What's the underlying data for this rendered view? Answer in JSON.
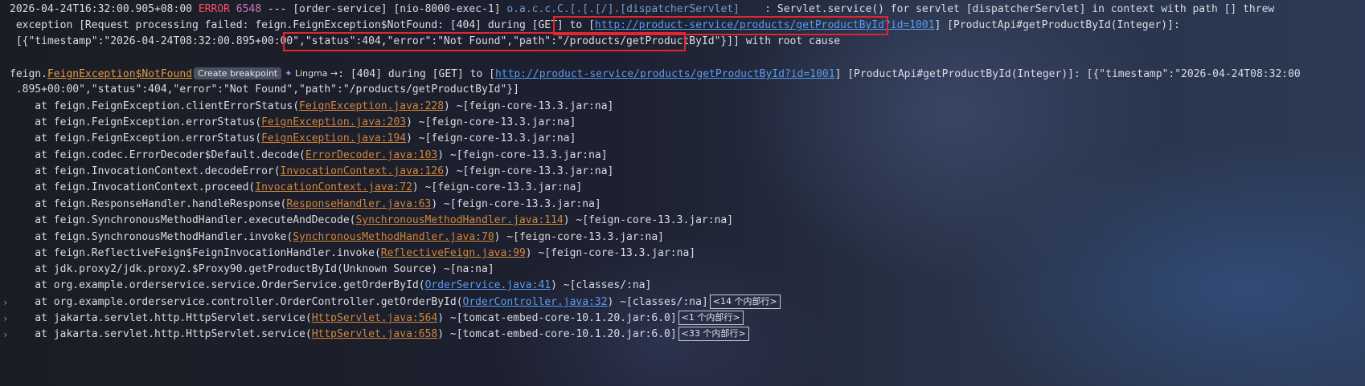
{
  "log": {
    "l1": {
      "timestamp": "2026-04-24T16:32:00.905+08:00",
      "level": "ERROR",
      "pid": "6548",
      "sep": " --- ",
      "service": "[order-service]",
      "thread": "[nio-8000-exec-1]",
      "logger": "o.a.c.c.C.[.[.[/].[dispatcherServlet]",
      "msg": "    : Servlet.service() for servlet [dispatcherServlet] in context with path [] threw"
    },
    "l2": {
      "pre": " exception [Request processing failed: feign.FeignException$NotFound: [404] during [GET] to ",
      "bracket_open": "[",
      "url": "http://product-service/products/getProductById?id=1001",
      "post": "] [ProductApi#getProductById(Integer)]:"
    },
    "l3": {
      "pre": " [{\"timestamp\":\"2026-04-24T08:32:00.895+00:00\"",
      "boxed": ",\"status\":404,\"error\":\"Not Found\",\"path\":\"/products/getProductById\"",
      "post": "}]] with root cause"
    },
    "l4": {
      "pre": "feign.",
      "cls": "FeignException$NotFound",
      "badge": "Create breakpoint",
      "lingma_icon": "✦",
      "lingma": "Lingma →",
      "mid": ": [404] during [GET] to [",
      "url": "http://product-service/products/getProductById?id=1001",
      "post": "] [ProductApi#getProductById(Integer)]: [{\"timestamp\":\"2026-04-24T08:32:00"
    },
    "l5": {
      "text": " .895+00:00\",\"status\":404,\"error\":\"Not Found\",\"path\":\"/products/getProductById\"}]"
    },
    "frames": [
      {
        "pre": "    at feign.FeignException.clientErrorStatus(",
        "link": "FeignException.java:228",
        "post": ") ~[feign-core-13.3.jar:na]",
        "kind": "feign",
        "gutter": "",
        "fold": ""
      },
      {
        "pre": "    at feign.FeignException.errorStatus(",
        "link": "FeignException.java:203",
        "post": ") ~[feign-core-13.3.jar:na]",
        "kind": "feign",
        "gutter": "",
        "fold": ""
      },
      {
        "pre": "    at feign.FeignException.errorStatus(",
        "link": "FeignException.java:194",
        "post": ") ~[feign-core-13.3.jar:na]",
        "kind": "feign",
        "gutter": "",
        "fold": ""
      },
      {
        "pre": "    at feign.codec.ErrorDecoder$Default.decode(",
        "link": "ErrorDecoder.java:103",
        "post": ") ~[feign-core-13.3.jar:na]",
        "kind": "feign",
        "gutter": "",
        "fold": ""
      },
      {
        "pre": "    at feign.InvocationContext.decodeError(",
        "link": "InvocationContext.java:126",
        "post": ") ~[feign-core-13.3.jar:na]",
        "kind": "feign",
        "gutter": "",
        "fold": ""
      },
      {
        "pre": "    at feign.InvocationContext.proceed(",
        "link": "InvocationContext.java:72",
        "post": ") ~[feign-core-13.3.jar:na]",
        "kind": "feign",
        "gutter": "",
        "fold": ""
      },
      {
        "pre": "    at feign.ResponseHandler.handleResponse(",
        "link": "ResponseHandler.java:63",
        "post": ") ~[feign-core-13.3.jar:na]",
        "kind": "feign",
        "gutter": "",
        "fold": ""
      },
      {
        "pre": "    at feign.SynchronousMethodHandler.executeAndDecode(",
        "link": "SynchronousMethodHandler.java:114",
        "post": ") ~[feign-core-13.3.jar:na]",
        "kind": "feign",
        "gutter": "",
        "fold": ""
      },
      {
        "pre": "    at feign.SynchronousMethodHandler.invoke(",
        "link": "SynchronousMethodHandler.java:70",
        "post": ") ~[feign-core-13.3.jar:na]",
        "kind": "feign",
        "gutter": "",
        "fold": ""
      },
      {
        "pre": "    at feign.ReflectiveFeign$FeignInvocationHandler.invoke(",
        "link": "ReflectiveFeign.java:99",
        "post": ") ~[feign-core-13.3.jar:na]",
        "kind": "feign",
        "gutter": "",
        "fold": ""
      },
      {
        "pre": "    at jdk.proxy2/jdk.proxy2.$Proxy90.getProductById(Unknown Source) ~[na:na]",
        "link": "",
        "post": "",
        "kind": "plain",
        "gutter": "",
        "fold": ""
      },
      {
        "pre": "    at org.example.orderservice.service.OrderService.getOrderById(",
        "link": "OrderService.java:41",
        "post": ") ~[classes/:na]",
        "kind": "user",
        "gutter": "",
        "fold": ""
      },
      {
        "pre": "    at org.example.orderservice.controller.OrderController.getOrderById(",
        "link": "OrderController.java:32",
        "post": ") ~[classes/:na]",
        "kind": "user",
        "gutter": "›",
        "fold": "<14 个内部行>"
      },
      {
        "pre": "    at jakarta.servlet.http.HttpServlet.service(",
        "link": "HttpServlet.java:564",
        "post": ") ~[tomcat-embed-core-10.1.20.jar:6.0]",
        "kind": "feign",
        "gutter": "›",
        "fold": "<1 个内部行>"
      },
      {
        "pre": "    at jakarta.servlet.http.HttpServlet.service(",
        "link": "HttpServlet.java:658",
        "post": ") ~[tomcat-embed-core-10.1.20.jar:6.0]",
        "kind": "feign",
        "gutter": "›",
        "fold": "<33 个内部行>"
      }
    ]
  },
  "colors": {
    "error": "#f75464",
    "pid": "#c77dbb",
    "logger": "#6f9dcc",
    "url_link": "#5a9bf0",
    "library_file_link": "#d1863a",
    "user_file_link": "#5a9bf0",
    "highlight_box": "#e0262e"
  }
}
